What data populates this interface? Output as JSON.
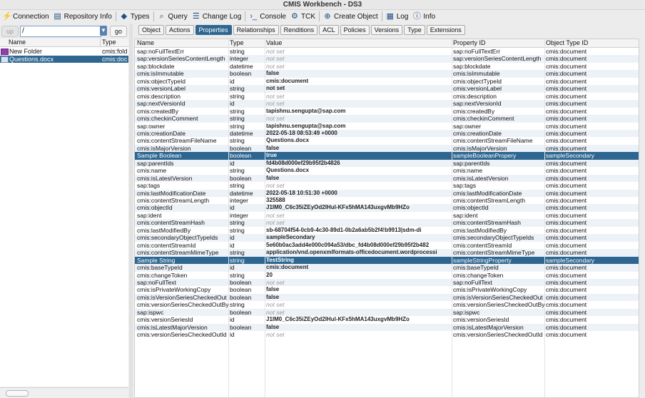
{
  "window": {
    "title": "CMIS Workbench - DS3"
  },
  "toolbar": [
    {
      "name": "connection-button",
      "icon": "plug-icon",
      "glyph": "⚡",
      "label": "Connection"
    },
    {
      "name": "repository-info-button",
      "icon": "repository-icon",
      "glyph": "▤",
      "label": "Repository Info"
    },
    {
      "name": "types-button",
      "icon": "tag-icon",
      "glyph": "◆",
      "label": "Types"
    },
    {
      "name": "query-button",
      "icon": "magnifier-icon",
      "glyph": "⌕",
      "label": "Query"
    },
    {
      "name": "change-log-button",
      "icon": "list-icon",
      "glyph": "☰",
      "label": "Change Log"
    },
    {
      "name": "console-button",
      "icon": "console-icon",
      "glyph": "›_",
      "label": "Console"
    },
    {
      "name": "tck-button",
      "icon": "gear-icon",
      "glyph": "⚙",
      "label": "TCK"
    },
    {
      "name": "create-object-button",
      "icon": "plus-circle-icon",
      "glyph": "⊕",
      "label": "Create Object"
    },
    {
      "name": "log-button",
      "icon": "printer-icon",
      "glyph": "▦",
      "label": "Log"
    },
    {
      "name": "info-button",
      "icon": "info-icon",
      "glyph": "ⓘ",
      "label": "Info"
    }
  ],
  "navigator": {
    "up_label": "up",
    "path_value": "/",
    "go_label": "go",
    "columns": [
      "Name",
      "Type"
    ],
    "rows": [
      {
        "name": "New Folder",
        "type": "cmis:fold",
        "kind": "folder",
        "selected": false
      },
      {
        "name": "Questions.docx",
        "type": "cmis:doc",
        "kind": "document",
        "selected": true
      }
    ]
  },
  "tabs": [
    {
      "label": "Object",
      "active": false
    },
    {
      "label": "Actions",
      "active": false
    },
    {
      "label": "Properties",
      "active": true
    },
    {
      "label": "Relationships",
      "active": false
    },
    {
      "label": "Renditions",
      "active": false
    },
    {
      "label": "ACL",
      "active": false
    },
    {
      "label": "Policies",
      "active": false
    },
    {
      "label": "Versions",
      "active": false
    },
    {
      "label": "Type",
      "active": false
    },
    {
      "label": "Extensions",
      "active": false
    }
  ],
  "properties": {
    "columns": [
      "Name",
      "Type",
      "Value",
      "Property ID",
      "Object Type ID"
    ],
    "rows": [
      {
        "name": "sap:noFullTextErr",
        "type": "string",
        "value": "not set",
        "notset": true,
        "pid": "sap:noFullTextErr",
        "otid": "cmis:document"
      },
      {
        "name": "sap:versionSeriesContentLength",
        "type": "integer",
        "value": "not set",
        "notset": true,
        "pid": "sap:versionSeriesContentLength",
        "otid": "cmis:document"
      },
      {
        "name": "sap:blockdate",
        "type": "datetime",
        "value": "not set",
        "notset": true,
        "pid": "sap:blockdate",
        "otid": "cmis:document"
      },
      {
        "name": "cmis:isImmutable",
        "type": "boolean",
        "value": "false",
        "notset": false,
        "pid": "cmis:isImmutable",
        "otid": "cmis:document"
      },
      {
        "name": "cmis:objectTypeId",
        "type": "id",
        "value": "cmis:document",
        "notset": false,
        "pid": "cmis:objectTypeId",
        "otid": "cmis:document"
      },
      {
        "name": "cmis:versionLabel",
        "type": "string",
        "value": "not set",
        "notset": false,
        "pid": "cmis:versionLabel",
        "otid": "cmis:document"
      },
      {
        "name": "cmis:description",
        "type": "string",
        "value": "not set",
        "notset": true,
        "pid": "cmis:description",
        "otid": "cmis:document"
      },
      {
        "name": "sap:nextVersionId",
        "type": "id",
        "value": "not set",
        "notset": true,
        "pid": "sap:nextVersionId",
        "otid": "cmis:document"
      },
      {
        "name": "cmis:createdBy",
        "type": "string",
        "value": "tapishnu.sengupta@sap.com",
        "notset": false,
        "pid": "cmis:createdBy",
        "otid": "cmis:document"
      },
      {
        "name": "cmis:checkinComment",
        "type": "string",
        "value": "not set",
        "notset": true,
        "pid": "cmis:checkinComment",
        "otid": "cmis:document"
      },
      {
        "name": "sap:owner",
        "type": "string",
        "value": "tapishnu.sengupta@sap.com",
        "notset": false,
        "pid": "sap:owner",
        "otid": "cmis:document"
      },
      {
        "name": "cmis:creationDate",
        "type": "datetime",
        "value": "2022-05-18 08:53:49 +0000",
        "notset": false,
        "pid": "cmis:creationDate",
        "otid": "cmis:document"
      },
      {
        "name": "cmis:contentStreamFileName",
        "type": "string",
        "value": "Questions.docx",
        "notset": false,
        "pid": "cmis:contentStreamFileName",
        "otid": "cmis:document"
      },
      {
        "name": "cmis:isMajorVersion",
        "type": "boolean",
        "value": "false",
        "notset": false,
        "pid": "cmis:isMajorVersion",
        "otid": "cmis:document"
      },
      {
        "name": "Sample Boolean",
        "type": "boolean",
        "value": "true",
        "notset": false,
        "pid": "sampleBooleanPropery",
        "otid": "sampleSecondary",
        "selected": true
      },
      {
        "name": "sap:parentIds",
        "type": "id",
        "value": "fd4b08d000ef29b95f2b4826",
        "notset": false,
        "pid": "sap:parentIds",
        "otid": "cmis:document"
      },
      {
        "name": "cmis:name",
        "type": "string",
        "value": "Questions.docx",
        "notset": false,
        "pid": "cmis:name",
        "otid": "cmis:document"
      },
      {
        "name": "cmis:isLatestVersion",
        "type": "boolean",
        "value": "false",
        "notset": false,
        "pid": "cmis:isLatestVersion",
        "otid": "cmis:document"
      },
      {
        "name": "sap:tags",
        "type": "string",
        "value": "not set",
        "notset": true,
        "pid": "sap:tags",
        "otid": "cmis:document"
      },
      {
        "name": "cmis:lastModificationDate",
        "type": "datetime",
        "value": "2022-05-18 10:51:30 +0000",
        "notset": false,
        "pid": "cmis:lastModificationDate",
        "otid": "cmis:document"
      },
      {
        "name": "cmis:contentStreamLength",
        "type": "integer",
        "value": "325588",
        "notset": false,
        "pid": "cmis:contentStreamLength",
        "otid": "cmis:document"
      },
      {
        "name": "cmis:objectId",
        "type": "id",
        "value": "J1IM0_C6c35iZEyOd2lHul-KFx5hMA143uxgvMb9HZo",
        "notset": false,
        "pid": "cmis:objectId",
        "otid": "cmis:document"
      },
      {
        "name": "sap:ident",
        "type": "integer",
        "value": "not set",
        "notset": true,
        "pid": "sap:ident",
        "otid": "cmis:document"
      },
      {
        "name": "cmis:contentStreamHash",
        "type": "string",
        "value": "not set",
        "notset": true,
        "pid": "cmis:contentStreamHash",
        "otid": "cmis:document"
      },
      {
        "name": "cmis:lastModifiedBy",
        "type": "string",
        "value": "sb-68704f54-0cb9-4c30-89d1-0b2a6ab5b2f4!b9913|sdm-di",
        "notset": false,
        "pid": "cmis:lastModifiedBy",
        "otid": "cmis:document"
      },
      {
        "name": "cmis:secondaryObjectTypeIds",
        "type": "id",
        "value": "sampleSecondary",
        "notset": false,
        "pid": "cmis:secondaryObjectTypeIds",
        "otid": "cmis:document"
      },
      {
        "name": "cmis:contentStreamId",
        "type": "id",
        "value": "5e60b0ac3add4e000c094a53/dbc_fd4b08d000ef29b95f2b482",
        "notset": false,
        "pid": "cmis:contentStreamId",
        "otid": "cmis:document"
      },
      {
        "name": "cmis:contentStreamMimeType",
        "type": "string",
        "value": "application/vnd.openxmlformats-officedocument.wordprocessi",
        "notset": false,
        "pid": "cmis:contentStreamMimeType",
        "otid": "cmis:document"
      },
      {
        "name": "Sample String",
        "type": "string",
        "value": "TestString",
        "notset": false,
        "pid": "sampleStringProperty",
        "otid": "sampleSecondary",
        "selected": true
      },
      {
        "name": "cmis:baseTypeId",
        "type": "id",
        "value": "cmis:document",
        "notset": false,
        "pid": "cmis:baseTypeId",
        "otid": "cmis:document"
      },
      {
        "name": "cmis:changeToken",
        "type": "string",
        "value": "20",
        "notset": false,
        "pid": "cmis:changeToken",
        "otid": "cmis:document"
      },
      {
        "name": "sap:noFullText",
        "type": "boolean",
        "value": "not set",
        "notset": true,
        "pid": "sap:noFullText",
        "otid": "cmis:document"
      },
      {
        "name": "cmis:isPrivateWorkingCopy",
        "type": "boolean",
        "value": "false",
        "notset": false,
        "pid": "cmis:isPrivateWorkingCopy",
        "otid": "cmis:document"
      },
      {
        "name": "cmis:isVersionSeriesCheckedOut",
        "type": "boolean",
        "value": "false",
        "notset": false,
        "pid": "cmis:isVersionSeriesCheckedOut",
        "otid": "cmis:document"
      },
      {
        "name": "cmis:versionSeriesCheckedOutBy",
        "type": "string",
        "value": "not set",
        "notset": true,
        "pid": "cmis:versionSeriesCheckedOutBy",
        "otid": "cmis:document"
      },
      {
        "name": "sap:ispwc",
        "type": "boolean",
        "value": "not set",
        "notset": true,
        "pid": "sap:ispwc",
        "otid": "cmis:document"
      },
      {
        "name": "cmis:versionSeriesId",
        "type": "id",
        "value": "J1IM0_C6c35iZEyOd2lHul-KFx5hMA143uxgvMb9HZo",
        "notset": false,
        "pid": "cmis:versionSeriesId",
        "otid": "cmis:document"
      },
      {
        "name": "cmis:isLatestMajorVersion",
        "type": "boolean",
        "value": "false",
        "notset": false,
        "pid": "cmis:isLatestMajorVersion",
        "otid": "cmis:document"
      },
      {
        "name": "cmis:versionSeriesCheckedOutId",
        "type": "id",
        "value": "not set",
        "notset": true,
        "pid": "cmis:versionSeriesCheckedOutId",
        "otid": "cmis:document"
      }
    ]
  }
}
